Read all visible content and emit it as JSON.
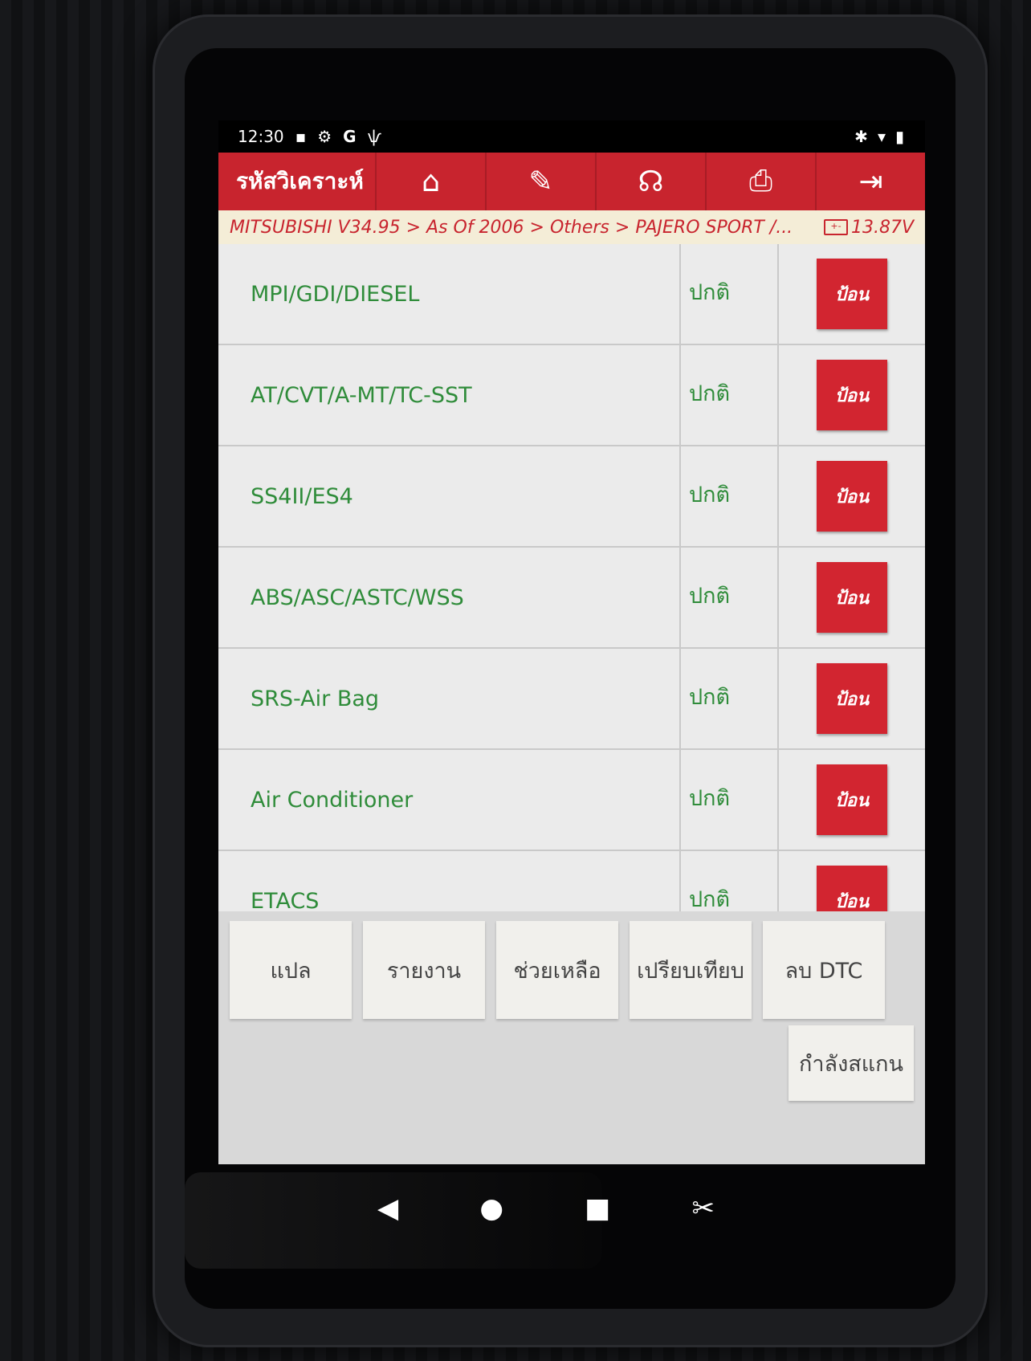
{
  "statusbar": {
    "time": "12:30",
    "left_icons": [
      "notification-icon",
      "settings-icon",
      "google-icon",
      "usb-icon"
    ],
    "right_icons": [
      "bluetooth-icon",
      "wifi-icon",
      "battery-icon"
    ]
  },
  "toolbar": {
    "title": "รหัสวิเคราะห์",
    "buttons": [
      {
        "icon": "home-icon",
        "glyph": "⌂"
      },
      {
        "icon": "edit-icon",
        "glyph": "✎"
      },
      {
        "icon": "support-icon",
        "glyph": "☊"
      },
      {
        "icon": "print-icon",
        "glyph": "⎙"
      },
      {
        "icon": "exit-icon",
        "glyph": "⇥"
      }
    ]
  },
  "breadcrumb": {
    "path": "MITSUBISHI V34.95 > As Of 2006 > Others > PAJERO SPORT /...",
    "voltage": "13.87V"
  },
  "systems": [
    {
      "name": "MPI/GDI/DIESEL",
      "status": "ปกติ",
      "action": "ป้อน"
    },
    {
      "name": "AT/CVT/A-MT/TC-SST",
      "status": "ปกติ",
      "action": "ป้อน"
    },
    {
      "name": "SS4II/ES4",
      "status": "ปกติ",
      "action": "ป้อน"
    },
    {
      "name": "ABS/ASC/ASTC/WSS",
      "status": "ปกติ",
      "action": "ป้อน"
    },
    {
      "name": "SRS-Air Bag",
      "status": "ปกติ",
      "action": "ป้อน"
    },
    {
      "name": "Air Conditioner",
      "status": "ปกติ",
      "action": "ป้อน"
    },
    {
      "name": "ETACS",
      "status": "ปกติ",
      "action": "ป้อน"
    }
  ],
  "footer": {
    "buttons": [
      "แปล",
      "รายงาน",
      "ช่วยเหลือ",
      "เปรียบเทียบ",
      "ลบ DTC"
    ],
    "scan": "กำลังสแกน"
  },
  "navbar": [
    {
      "icon": "back-icon",
      "glyph": "◀"
    },
    {
      "icon": "home-nav-icon",
      "glyph": "●"
    },
    {
      "icon": "recents-icon",
      "glyph": "■"
    },
    {
      "icon": "screenshot-icon",
      "glyph": "✂"
    }
  ],
  "colors": {
    "accent": "#c8242e",
    "text_green": "#2f8c3a",
    "breadcrumb_bg": "#f4edd7"
  }
}
